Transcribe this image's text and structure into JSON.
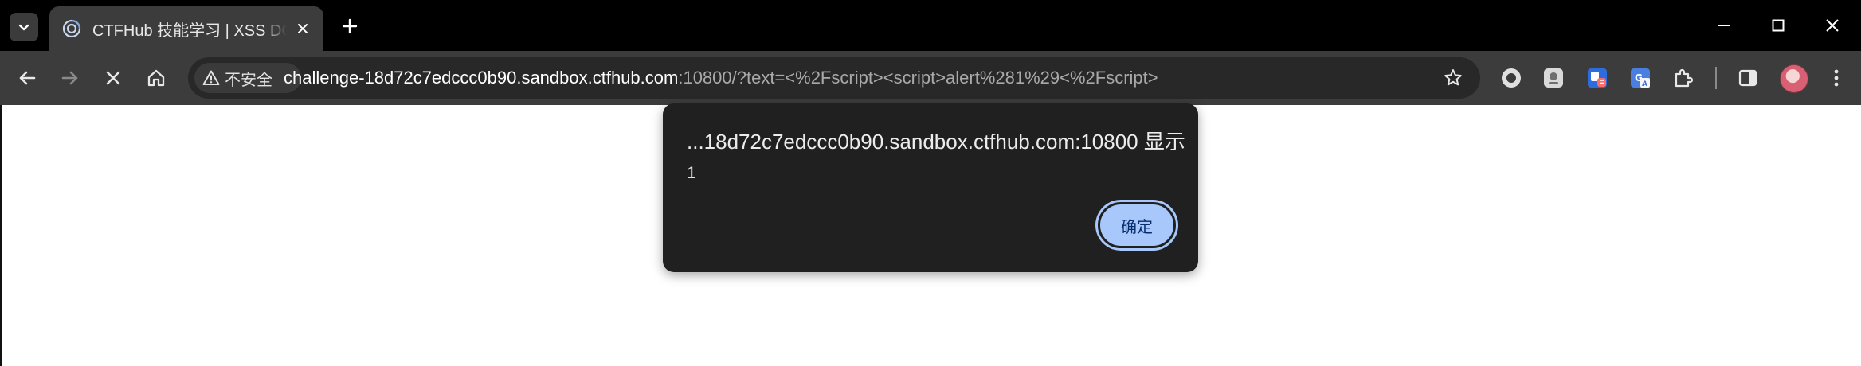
{
  "tab": {
    "title": "CTFHub 技能学习 | XSS DOM",
    "favicon": "ctfhub-icon"
  },
  "toolbar": {
    "security_label": "不安全",
    "url_host": "challenge-18d72c7edccc0b90.sandbox.ctfhub.com",
    "url_rest": ":10800/?text=<%2Fscript><script>alert%281%29<%2Fscript>"
  },
  "dialog": {
    "title": "...18d72c7edccc0b90.sandbox.ctfhub.com:10800 显示",
    "message": "1",
    "ok_label": "确定"
  },
  "colors": {
    "tabstrip": "#000000",
    "toolbar": "#3c3c3c",
    "omnibox": "#282828",
    "dialog_bg": "#202020",
    "button_accent": "#a8c7fa"
  }
}
